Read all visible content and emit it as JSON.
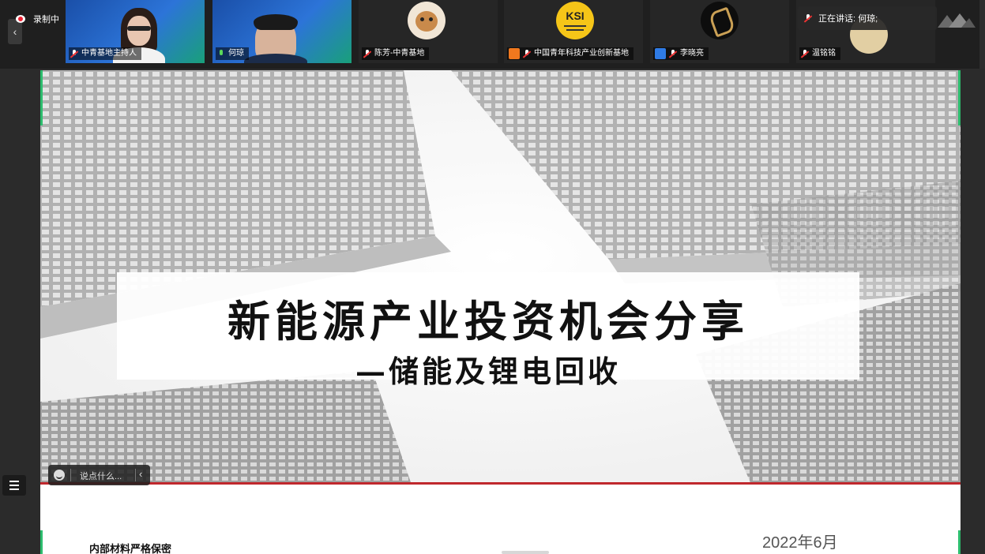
{
  "recording": {
    "label": "录制中"
  },
  "participants": [
    {
      "name": "中青基地主持人",
      "type": "video",
      "mic": "muted"
    },
    {
      "name": "何琼",
      "type": "video",
      "mic": "active"
    },
    {
      "name": "陈芳-中青基地",
      "type": "avatar",
      "avatar": "cat-icon",
      "mic": "muted"
    },
    {
      "name": "中国青年科技产业创新基地",
      "type": "logo",
      "avatar_text": "KSI",
      "mic": "muted"
    },
    {
      "name": "李晓亮",
      "type": "avatar",
      "avatar": "calligraphy-logo",
      "mic": "muted"
    },
    {
      "name": "温铭铭",
      "type": "avatar",
      "mic": "muted"
    }
  ],
  "speaking": {
    "label": "正在讲话: 何琼;"
  },
  "slide": {
    "title": "新能源产业投资机会分享",
    "subtitle": "—储能及锂电回收",
    "confidential": "内部材料严格保密",
    "date": "2022年6月"
  },
  "chat": {
    "placeholder": "说点什么..."
  },
  "colors": {
    "accent_green": "#2dbd6e",
    "rule_red": "#c0282d",
    "top_bar": "#1f1f1f"
  }
}
